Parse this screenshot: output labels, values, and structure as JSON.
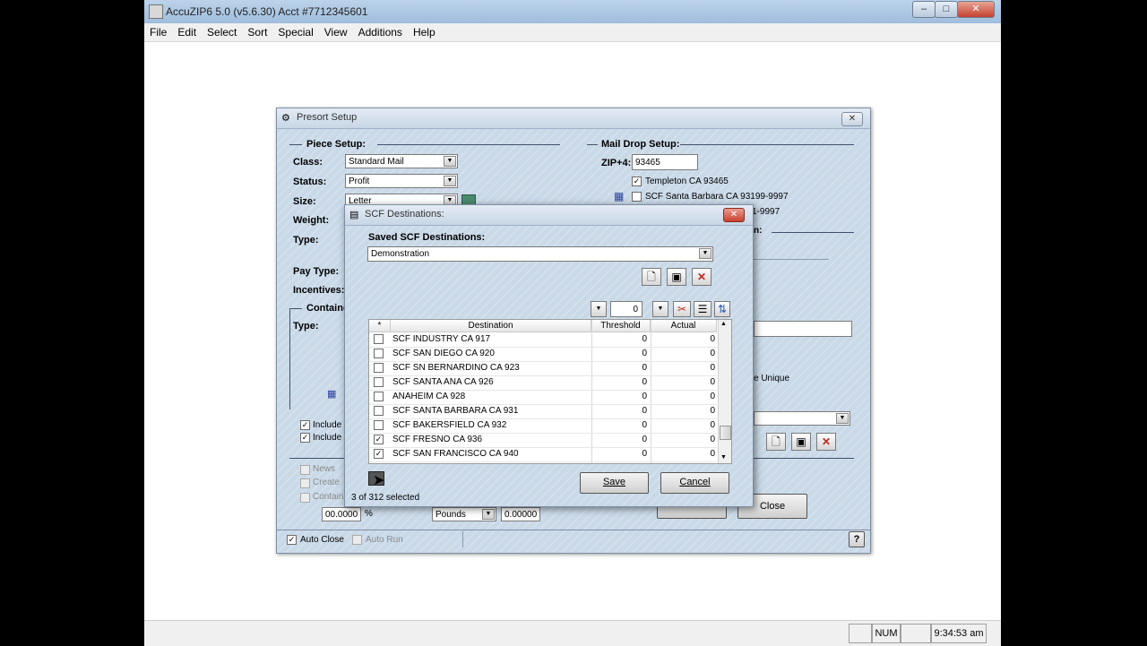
{
  "app": {
    "title": "AccuZIP6 5.0 (v5.6.30) Acct #7712345601",
    "window_buttons": [
      "–",
      "□",
      "✕"
    ],
    "menu": [
      "File",
      "Edit",
      "Select",
      "Sort",
      "Special",
      "View",
      "Additions",
      "Help"
    ],
    "status": {
      "num": "NUM",
      "time": "9:34:53 am"
    }
  },
  "presort": {
    "title": "Presort Setup",
    "piece_setup": "Piece Setup:",
    "class_label": "Class:",
    "class_value": "Standard Mail",
    "status_label": "Status:",
    "status_value": "Profit",
    "size_label": "Size:",
    "size_value": "Letter",
    "weight_label": "Weight:",
    "type_label": "Type:",
    "paytype_label": "Pay Type:",
    "incentives_label": "Incentives:",
    "container_label": "Containe",
    "container_type_label": "Type:",
    "include1": "Include",
    "include2": "Include",
    "news": "News",
    "create": "Create",
    "contain": "Contain",
    "pct_value": "00.0000",
    "pct_unit": "%",
    "pounds_value": "Pounds",
    "weight_value": "0.00000",
    "mail_drop": "Mail Drop Setup:",
    "zip_label": "ZIP+4:",
    "zip_value": "93465",
    "templeton": "Templeton CA 93465",
    "scf_sb": "SCF Santa Barbara CA 93199-9997",
    "partial1": "1-9997",
    "partial2": "n:",
    "unique": "e Unique",
    "close": "Close",
    "auto_close": "Auto Close",
    "auto_run": "Auto Run",
    "help": "?"
  },
  "scf": {
    "title": "SCF Destinations:",
    "saved_label": "Saved SCF Destinations:",
    "saved_value": "Demonstration",
    "counter_value": "0",
    "columns": [
      "*",
      "Destination",
      "Threshold",
      "Actual"
    ],
    "rows": [
      {
        "name": "SCF INDUSTRY CA 917",
        "threshold": "0",
        "actual": "0",
        "checked": false
      },
      {
        "name": "SCF SAN DIEGO CA 920",
        "threshold": "0",
        "actual": "0",
        "checked": false
      },
      {
        "name": "SCF SN BERNARDINO CA 923",
        "threshold": "0",
        "actual": "0",
        "checked": false
      },
      {
        "name": "SCF SANTA ANA CA 926",
        "threshold": "0",
        "actual": "0",
        "checked": false
      },
      {
        "name": "ANAHEIM CA 928",
        "threshold": "0",
        "actual": "0",
        "checked": false
      },
      {
        "name": "SCF SANTA BARBARA CA 931",
        "threshold": "0",
        "actual": "0",
        "checked": false
      },
      {
        "name": "SCF BAKERSFIELD CA 932",
        "threshold": "0",
        "actual": "0",
        "checked": false
      },
      {
        "name": "SCF FRESNO CA 936",
        "threshold": "0",
        "actual": "0",
        "checked": true
      },
      {
        "name": "SCF SAN FRANCISCO CA 940",
        "threshold": "0",
        "actual": "0",
        "checked": true
      }
    ],
    "selected_text": "3 of 312 selected",
    "save": "Save",
    "cancel": "Cancel"
  }
}
